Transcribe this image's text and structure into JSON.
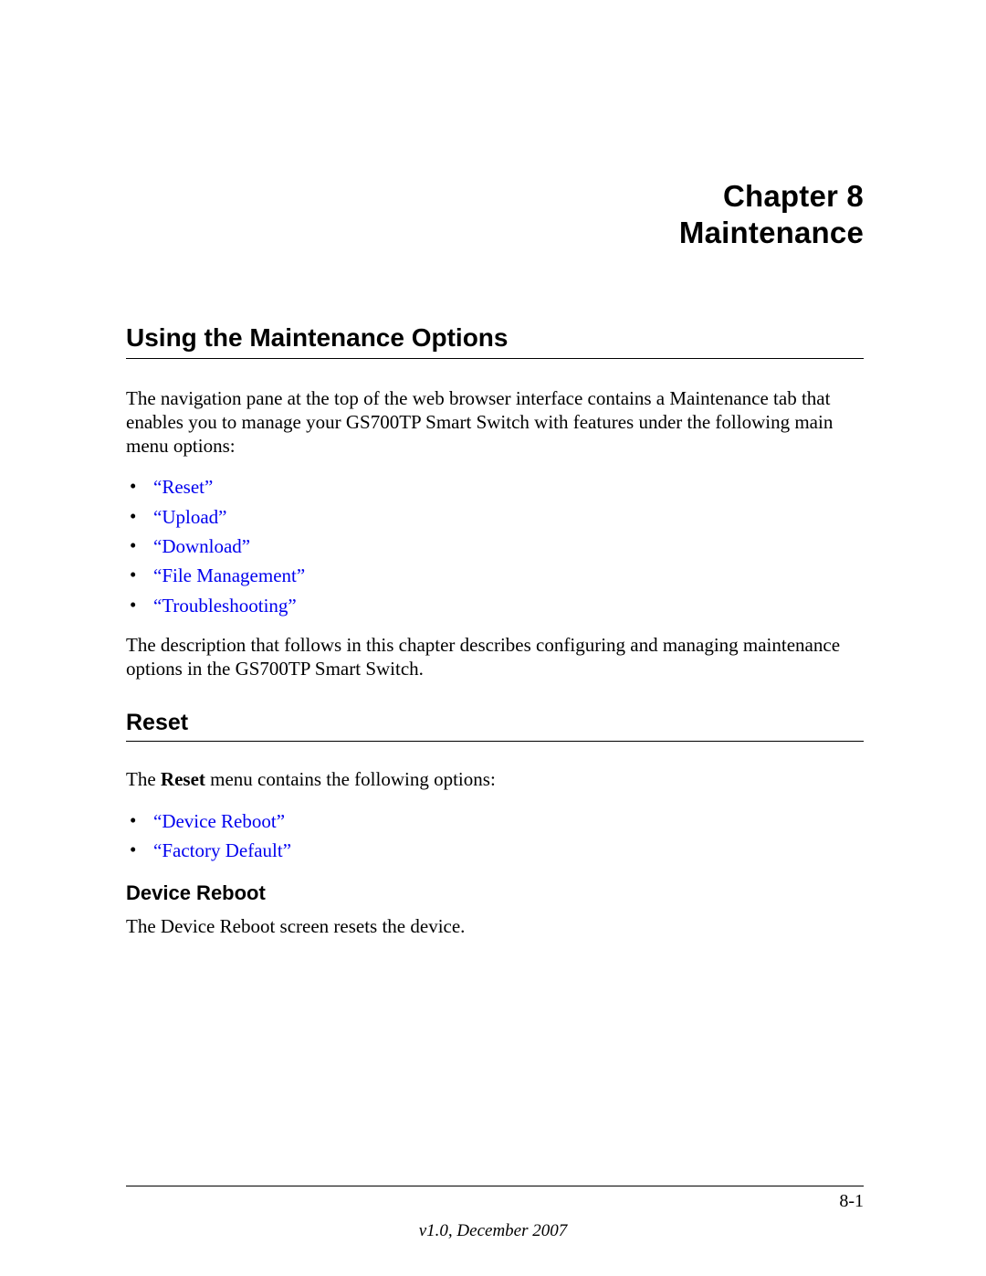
{
  "chapter": {
    "line1": "Chapter 8",
    "line2": "Maintenance"
  },
  "section1": {
    "title": "Using the Maintenance Options",
    "para1": "The navigation pane at the top of the web browser interface contains a Maintenance tab that enables you to manage your GS700TP Smart Switch with features under the following main menu options:",
    "links": [
      "“Reset”",
      "“Upload”",
      "“Download”",
      "“File Management”",
      "“Troubleshooting”"
    ],
    "para2": "The description that follows in this chapter describes configuring and managing maintenance options in the GS700TP Smart Switch."
  },
  "section2": {
    "title": "Reset",
    "intro_pre": "The ",
    "intro_bold": "Reset",
    "intro_post": " menu contains the following options:",
    "links": [
      "“Device Reboot”",
      "“Factory Default”"
    ]
  },
  "section3": {
    "title": "Device Reboot",
    "para": "The Device Reboot screen resets the device."
  },
  "footer": {
    "page": "8-1",
    "version": "v1.0, December 2007"
  }
}
